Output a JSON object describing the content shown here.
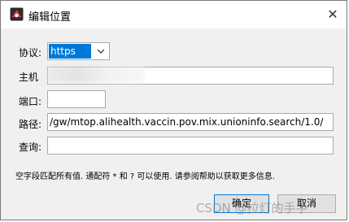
{
  "window": {
    "title": "编辑位置",
    "close_glyph": "✕"
  },
  "form": {
    "protocol_label": "协议:",
    "protocol_value": "https",
    "host_label": "主机",
    "host_value": "",
    "port_label": "端口:",
    "port_value": "",
    "path_label": "路径:",
    "path_value": "/gw/mtop.alihealth.vaccin.pov.mix.unioninfo.search/1.0/",
    "query_label": "查询:",
    "query_value": ""
  },
  "hint": "空字段匹配所有值. 通配符 * 和 ? 可以使用. 请参阅帮助以获取更多信息.",
  "buttons": {
    "ok": "确定",
    "cancel": "取消"
  },
  "watermark": "CSDN @拉灯的手手",
  "colors": {
    "selection": "#0078d7",
    "dialog_bg": "#f0f0f0"
  }
}
